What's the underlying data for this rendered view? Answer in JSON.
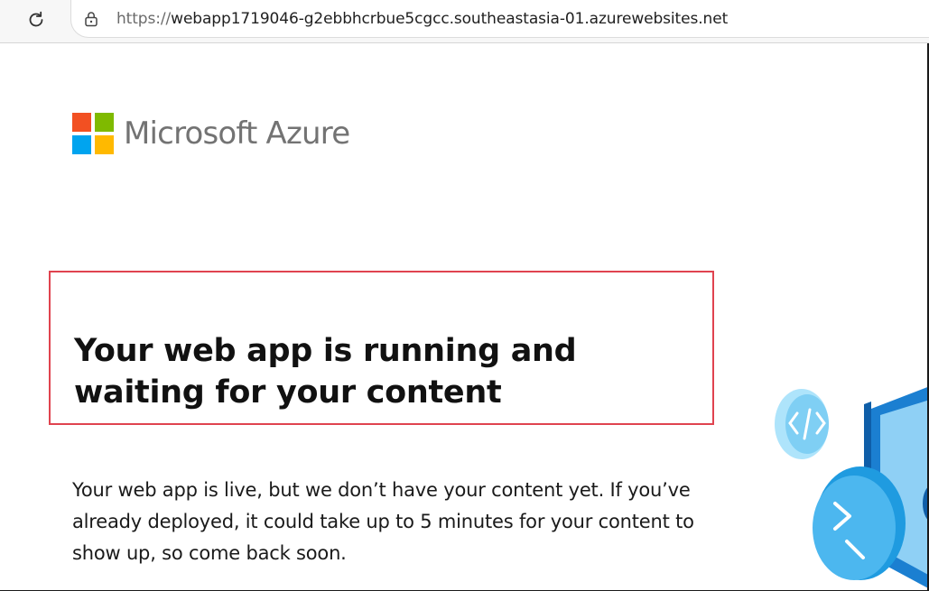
{
  "browser": {
    "url_scheme": "https://",
    "url_host": "webapp1719046-g2ebbhcrbue5cgcc.southeastasia-01.azurewebsites.net"
  },
  "page": {
    "logo_text": "Microsoft Azure",
    "heading": "Your web app is running and waiting for your content",
    "body": "Your web app is live, but we don’t have your content yet. If you’ve already deployed, it could take up to 5 minutes for your content to show up, so come back soon."
  },
  "colors": {
    "highlight_border": "#e0434f",
    "ms_red": "#f25022",
    "ms_green": "#7fba00",
    "ms_blue": "#00a4ef",
    "ms_yellow": "#ffb900"
  },
  "icons": {
    "reload": "reload-icon",
    "lock": "lock-icon",
    "illustration": "code-monitor-illustration"
  }
}
